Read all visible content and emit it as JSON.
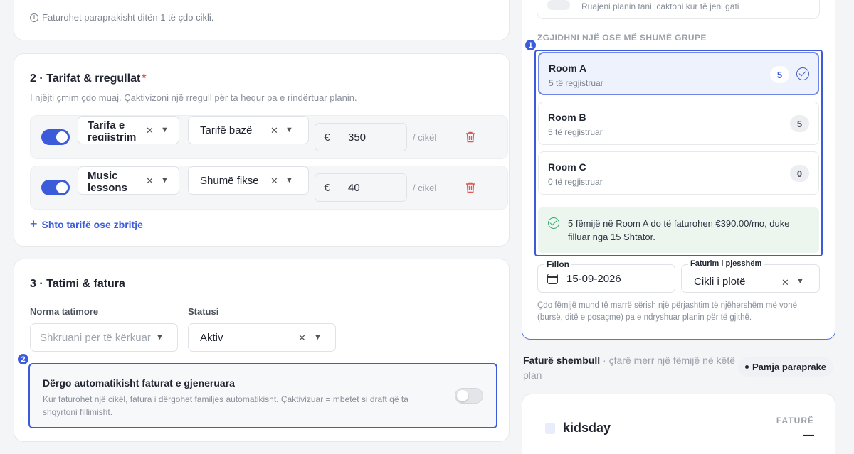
{
  "billing_info": "Faturohet paraprakisht ditën 1 të çdo cikli.",
  "section2": {
    "title": "2 · Tarifat & rregullat",
    "required_mark": "*",
    "subtitle": "I njëjti çmim çdo muaj. Çaktivizoni një rregull për ta hequr pa e rindërtuar planin.",
    "rules": [
      {
        "name": "Tarifa e regjistrimit",
        "type": "Tarifë bazë",
        "currency": "€",
        "amount": "350",
        "period": "/ cikël",
        "enabled": true
      },
      {
        "name": "Music lessons",
        "type": "Shumë fikse",
        "currency": "€",
        "amount": "40",
        "period": "/ cikël",
        "enabled": true
      }
    ],
    "add_label": "Shto tarifë ose zbritje"
  },
  "section3": {
    "title": "3 · Tatimi & fatura",
    "tax_label": "Norma tatimore",
    "tax_placeholder": "Shkruani për të kërkuar",
    "status_label": "Statusi",
    "status_value": "Aktiv",
    "auto_send_title": "Dërgo automatikisht faturat e gjeneruara",
    "auto_send_desc": "Kur faturohet një cikël, fatura i dërgohet familjes automatikisht. Çaktivizuar = mbetet si draft që ta shqyrtoni fillimisht.",
    "auto_send_enabled": false
  },
  "annotations": [
    "1",
    "2"
  ],
  "right_panel": {
    "top_hint": "Ruajeni planin tani, caktoni kur të jeni gati",
    "groups_label": "ZGJIDHNI NJË OSE MË SHUMË GRUPE",
    "rooms": [
      {
        "name": "Room A",
        "count_text": "5 të regjistruar",
        "count": "5",
        "selected": true
      },
      {
        "name": "Room B",
        "count_text": "5 të regjistruar",
        "count": "5",
        "selected": false
      },
      {
        "name": "Room C",
        "count_text": "0 të regjistruar",
        "count": "0",
        "selected": false
      }
    ],
    "summary": "5 fëmijë në Room A do të faturohen €390.00/mo, duke filluar nga 15 Shtator.",
    "start_label": "Fillon",
    "start_value": "15-09-2026",
    "partial_label": "Faturim i pjesshëm",
    "partial_value": "Cikli i plotë",
    "help_text": "Çdo fëmijë mund të marrë sërish një përjashtim të njëhershëm më vonë (bursë, ditë e posaçme) pa e ndryshuar planin për të gjithë."
  },
  "example": {
    "title": "Faturë shembull",
    "subtitle": "· çfarë merr një fëmijë në këtë plan",
    "preview_label": "Pamja paraprake",
    "brand": "kidsday",
    "invoice_label": "FATURË",
    "invoice_value": "—"
  },
  "colors": {
    "accent": "#3b5bdb",
    "danger": "#e25555",
    "success": "#3aa76d"
  }
}
